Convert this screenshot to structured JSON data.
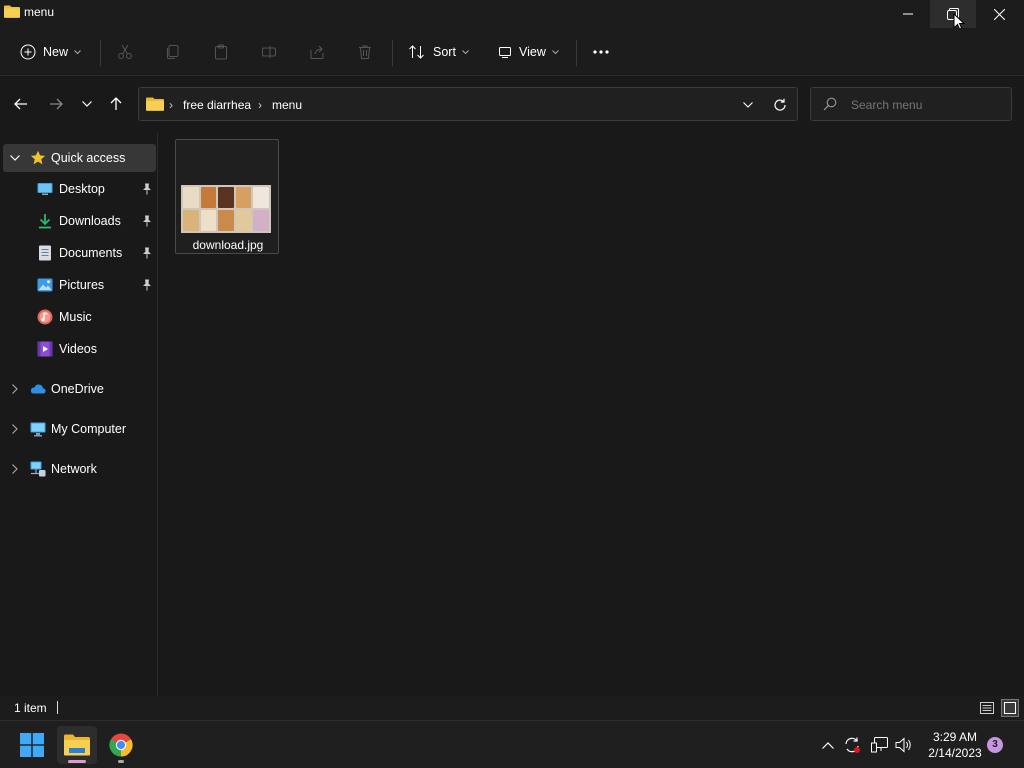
{
  "window": {
    "title": "menu"
  },
  "toolbar": {
    "new_label": "New",
    "sort_label": "Sort",
    "view_label": "View"
  },
  "address": {
    "crumbs": [
      "free diarrhea",
      "menu"
    ]
  },
  "search": {
    "placeholder": "Search menu"
  },
  "sidebar": {
    "quick_access": "Quick access",
    "items": [
      {
        "label": "Desktop",
        "icon": "desktop-icon",
        "pinned": true
      },
      {
        "label": "Downloads",
        "icon": "download-icon",
        "pinned": true
      },
      {
        "label": "Documents",
        "icon": "document-icon",
        "pinned": true
      },
      {
        "label": "Pictures",
        "icon": "pictures-icon",
        "pinned": true
      },
      {
        "label": "Music",
        "icon": "music-icon",
        "pinned": false
      },
      {
        "label": "Videos",
        "icon": "videos-icon",
        "pinned": false
      }
    ],
    "roots": [
      {
        "label": "OneDrive",
        "icon": "cloud-icon"
      },
      {
        "label": "My Computer",
        "icon": "computer-icon"
      },
      {
        "label": "Network",
        "icon": "network-icon"
      }
    ]
  },
  "files": [
    {
      "name": "download.jpg"
    }
  ],
  "status": {
    "count": "1 item"
  },
  "taskbar": {
    "time": "3:29 AM",
    "date": "2/14/2023",
    "notifications": "3"
  },
  "colors": {
    "accent_folder": "#f0c13e",
    "star": "#f2c12e",
    "selected_bg": "#373737",
    "explorer_indicator": "#e695d0",
    "notification_badge": "#c796e0"
  }
}
